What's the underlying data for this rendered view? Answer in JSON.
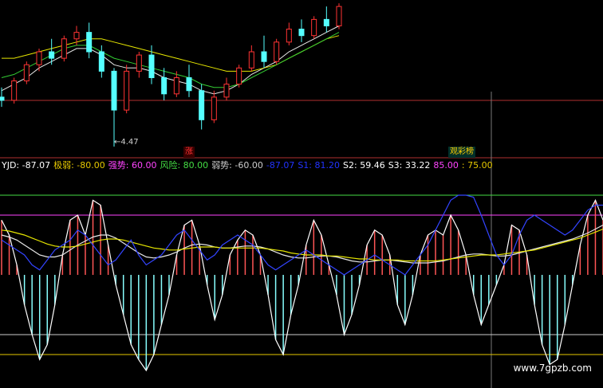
{
  "header": {
    "items": [
      {
        "label": "YJD: -87.07",
        "color": "#ffffff"
      },
      {
        "label": "极弱: -80.00",
        "color": "#e6c800"
      },
      {
        "label": "强势: 60.00",
        "color": "#ff44ff"
      },
      {
        "label": "风险: 80.00",
        "color": "#44dd44"
      },
      {
        "label": "弱势: -60.00",
        "color": "#cccccc"
      },
      {
        "label": "-87.07",
        "color": "#2233ff"
      },
      {
        "label": "S1: 81.20",
        "color": "#2233ff"
      },
      {
        "label": "S2: 59.46",
        "color": "#ffffff"
      },
      {
        "label": "S3: 33.22",
        "color": "#ffffff"
      },
      {
        "label": "85.00",
        "color": "#ff44ff"
      },
      {
        "label": ": 75.00",
        "color": "#e6c800"
      }
    ]
  },
  "price_panel": {
    "low_label": "←4.47",
    "badge_rise": "涨",
    "badge_watch": "观彩榜"
  },
  "watermark": "www.7gpzb.com",
  "colors": {
    "up": "#ff3333",
    "down": "#55ffff",
    "grid": "#b03030",
    "bar_up": "#ff5555",
    "bar_down": "#88ffff",
    "osc": "#ffffff",
    "ma_white": "#e8e8e8",
    "ma_yellow": "#e6e600",
    "ma_green": "#33cc33",
    "blue": "#3344ff"
  },
  "chart_data": [
    {
      "type": "candlestick",
      "title": "",
      "annotations": [
        "←4.47"
      ],
      "candles": [
        {
          "o": 6.0,
          "h": 6.3,
          "l": 5.7,
          "c": 5.9
        },
        {
          "o": 5.9,
          "h": 6.6,
          "l": 5.8,
          "c": 6.5
        },
        {
          "o": 6.5,
          "h": 7.1,
          "l": 6.4,
          "c": 7.0
        },
        {
          "o": 7.0,
          "h": 7.5,
          "l": 6.8,
          "c": 7.4
        },
        {
          "o": 7.4,
          "h": 7.8,
          "l": 7.0,
          "c": 7.2
        },
        {
          "o": 7.2,
          "h": 7.9,
          "l": 7.1,
          "c": 7.8
        },
        {
          "o": 7.8,
          "h": 8.2,
          "l": 7.6,
          "c": 8.0
        },
        {
          "o": 8.0,
          "h": 8.3,
          "l": 7.2,
          "c": 7.4
        },
        {
          "o": 7.4,
          "h": 7.6,
          "l": 6.6,
          "c": 6.8
        },
        {
          "o": 6.8,
          "h": 6.9,
          "l": 4.47,
          "c": 5.6
        },
        {
          "o": 5.6,
          "h": 7.0,
          "l": 5.5,
          "c": 6.8
        },
        {
          "o": 6.8,
          "h": 7.4,
          "l": 6.6,
          "c": 7.3
        },
        {
          "o": 7.3,
          "h": 7.6,
          "l": 6.4,
          "c": 6.6
        },
        {
          "o": 6.6,
          "h": 6.9,
          "l": 5.9,
          "c": 6.1
        },
        {
          "o": 6.1,
          "h": 6.8,
          "l": 6.0,
          "c": 6.6
        },
        {
          "o": 6.6,
          "h": 7.0,
          "l": 6.0,
          "c": 6.2
        },
        {
          "o": 6.2,
          "h": 6.4,
          "l": 5.0,
          "c": 5.3
        },
        {
          "o": 5.3,
          "h": 6.2,
          "l": 5.2,
          "c": 6.0
        },
        {
          "o": 6.0,
          "h": 6.6,
          "l": 5.9,
          "c": 6.4
        },
        {
          "o": 6.4,
          "h": 7.0,
          "l": 6.3,
          "c": 6.9
        },
        {
          "o": 6.9,
          "h": 7.6,
          "l": 6.8,
          "c": 7.4
        },
        {
          "o": 7.4,
          "h": 7.9,
          "l": 6.9,
          "c": 7.1
        },
        {
          "o": 7.1,
          "h": 7.8,
          "l": 7.0,
          "c": 7.7
        },
        {
          "o": 7.7,
          "h": 8.3,
          "l": 7.6,
          "c": 8.1
        },
        {
          "o": 8.1,
          "h": 8.4,
          "l": 7.7,
          "c": 7.9
        },
        {
          "o": 7.9,
          "h": 8.5,
          "l": 7.8,
          "c": 8.4
        },
        {
          "o": 8.4,
          "h": 8.8,
          "l": 8.0,
          "c": 8.2
        },
        {
          "o": 8.2,
          "h": 8.9,
          "l": 8.1,
          "c": 8.8
        }
      ],
      "ma": [
        {
          "color": "#e8e8e8",
          "values": [
            6.2,
            6.4,
            6.6,
            6.9,
            7.1,
            7.3,
            7.5,
            7.5,
            7.3,
            7.0,
            6.9,
            6.9,
            6.8,
            6.6,
            6.5,
            6.4,
            6.2,
            6.1,
            6.2,
            6.4,
            6.7,
            6.9,
            7.1,
            7.4,
            7.6,
            7.8,
            8.0,
            8.2
          ]
        },
        {
          "color": "#e6e600",
          "values": [
            7.2,
            7.2,
            7.3,
            7.4,
            7.5,
            7.6,
            7.7,
            7.8,
            7.8,
            7.7,
            7.6,
            7.5,
            7.4,
            7.3,
            7.2,
            7.1,
            7.0,
            6.9,
            6.8,
            6.8,
            6.8,
            6.9,
            7.0,
            7.2,
            7.4,
            7.6,
            7.8,
            7.9
          ]
        },
        {
          "color": "#33cc33",
          "values": [
            6.6,
            6.7,
            6.9,
            7.1,
            7.3,
            7.5,
            7.6,
            7.6,
            7.4,
            7.2,
            7.1,
            7.0,
            6.9,
            6.8,
            6.7,
            6.6,
            6.4,
            6.3,
            6.3,
            6.4,
            6.6,
            6.8,
            7.0,
            7.2,
            7.4,
            7.6,
            7.8,
            8.0
          ]
        }
      ]
    },
    {
      "type": "line",
      "title": "",
      "ylim": [
        -100,
        100
      ],
      "levels": [
        {
          "name": "极弱",
          "value": -80
        },
        {
          "name": "强势",
          "value": 60
        },
        {
          "name": "风险",
          "value": 80
        },
        {
          "name": "弱势",
          "value": -60
        }
      ],
      "x": [
        0,
        1,
        2,
        3,
        4,
        5,
        6,
        7,
        8,
        9,
        10,
        11,
        12,
        13,
        14,
        15,
        16,
        17,
        18,
        19,
        20,
        21,
        22,
        23,
        24,
        25,
        26,
        27,
        28,
        29,
        30,
        31,
        32,
        33,
        34,
        35,
        36,
        37,
        38,
        39,
        40,
        41,
        42,
        43,
        44,
        45,
        46,
        47,
        48,
        49,
        50,
        51,
        52,
        53,
        54,
        55,
        56,
        57,
        58,
        59,
        60,
        61,
        62,
        63,
        64,
        65,
        66,
        67,
        68,
        69,
        70,
        71,
        72,
        73,
        74,
        75,
        76,
        77,
        78,
        79
      ],
      "series": [
        {
          "values": [
            55,
            40,
            10,
            -30,
            -60,
            -85,
            -70,
            -30,
            20,
            55,
            60,
            40,
            75,
            70,
            30,
            -10,
            -40,
            -70,
            -85,
            -96,
            -80,
            -50,
            -20,
            20,
            50,
            55,
            30,
            -10,
            -45,
            -20,
            20,
            35,
            45,
            40,
            20,
            -20,
            -65,
            -80,
            -40,
            -10,
            30,
            55,
            40,
            10,
            -20,
            -60,
            -40,
            -10,
            30,
            45,
            40,
            20,
            -30,
            -50,
            -20,
            20,
            40,
            45,
            40,
            60,
            45,
            20,
            -20,
            -50,
            -30,
            -10,
            10,
            50,
            45,
            20,
            -30,
            -70,
            -90,
            -85,
            -50,
            -10,
            30,
            60,
            75,
            55
          ]
        },
        {
          "values": [
            40,
            38,
            35,
            30,
            25,
            20,
            18,
            18,
            20,
            25,
            30,
            34,
            38,
            40,
            40,
            37,
            32,
            27,
            22,
            18,
            17,
            18,
            20,
            23,
            27,
            30,
            31,
            30,
            28,
            27,
            27,
            28,
            29,
            29,
            28,
            26,
            23,
            20,
            18,
            17,
            17,
            18,
            19,
            19,
            18,
            16,
            14,
            13,
            13,
            14,
            15,
            15,
            14,
            13,
            12,
            12,
            12,
            13,
            14,
            16,
            18,
            20,
            21,
            21,
            20,
            19,
            19,
            20,
            22,
            24,
            26,
            28,
            30,
            32,
            34,
            36,
            39,
            42,
            46,
            50
          ]
        },
        {
          "values": [
            45,
            44,
            42,
            40,
            37,
            34,
            31,
            29,
            28,
            28,
            29,
            31,
            33,
            35,
            36,
            36,
            35,
            33,
            31,
            29,
            27,
            26,
            25,
            25,
            26,
            27,
            28,
            28,
            28,
            27,
            27,
            27,
            27,
            27,
            27,
            26,
            25,
            24,
            22,
            21,
            20,
            20,
            20,
            19,
            19,
            18,
            17,
            16,
            16,
            15,
            15,
            15,
            15,
            14,
            14,
            14,
            14,
            14,
            15,
            16,
            17,
            18,
            19,
            20,
            20,
            20,
            21,
            22,
            23,
            24,
            25,
            27,
            29,
            31,
            33,
            35,
            37,
            40,
            43,
            46
          ]
        },
        {
          "values": [
            35,
            30,
            25,
            20,
            10,
            5,
            15,
            25,
            30,
            35,
            45,
            40,
            30,
            20,
            10,
            15,
            25,
            35,
            20,
            10,
            15,
            20,
            30,
            40,
            45,
            35,
            25,
            15,
            20,
            30,
            35,
            40,
            35,
            30,
            20,
            10,
            5,
            10,
            15,
            20,
            25,
            20,
            15,
            10,
            5,
            0,
            5,
            10,
            15,
            20,
            15,
            10,
            5,
            0,
            10,
            20,
            30,
            45,
            60,
            75,
            80,
            80,
            78,
            60,
            40,
            20,
            10,
            20,
            40,
            55,
            60,
            55,
            50,
            45,
            40,
            45,
            55,
            65,
            70,
            70
          ]
        }
      ]
    }
  ]
}
